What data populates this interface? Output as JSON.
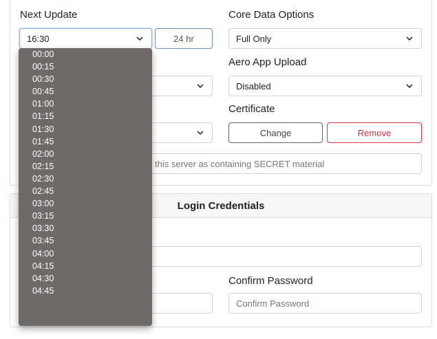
{
  "next_update": {
    "label": "Next Update",
    "value": "16:30",
    "format_button": "24 hr",
    "options": [
      "00:00",
      "00:15",
      "00:30",
      "00:45",
      "01:00",
      "01:15",
      "01:30",
      "01:45",
      "02:00",
      "02:15",
      "02:30",
      "02:45",
      "03:00",
      "03:15",
      "03:30",
      "03:45",
      "04:00",
      "04:15",
      "04:30",
      "04:45"
    ]
  },
  "core_data_options": {
    "label": "Core Data Options",
    "value": "Full Only"
  },
  "aero_app_upload": {
    "label": "Aero App Upload",
    "value": "Disabled"
  },
  "certificate": {
    "label": "Certificate",
    "change_label": "Change",
    "remove_label": "Remove"
  },
  "secret_field": {
    "text": "this server as containing SECRET material"
  },
  "login_credentials": {
    "header": "Login Credentials",
    "confirm_password_label": "Confirm Password",
    "confirm_password_placeholder": "Confirm Password"
  },
  "colors": {
    "remove": "#dc3545",
    "dropdown_bg": "#6f6a6a",
    "focus_border": "#8cb6f2"
  }
}
